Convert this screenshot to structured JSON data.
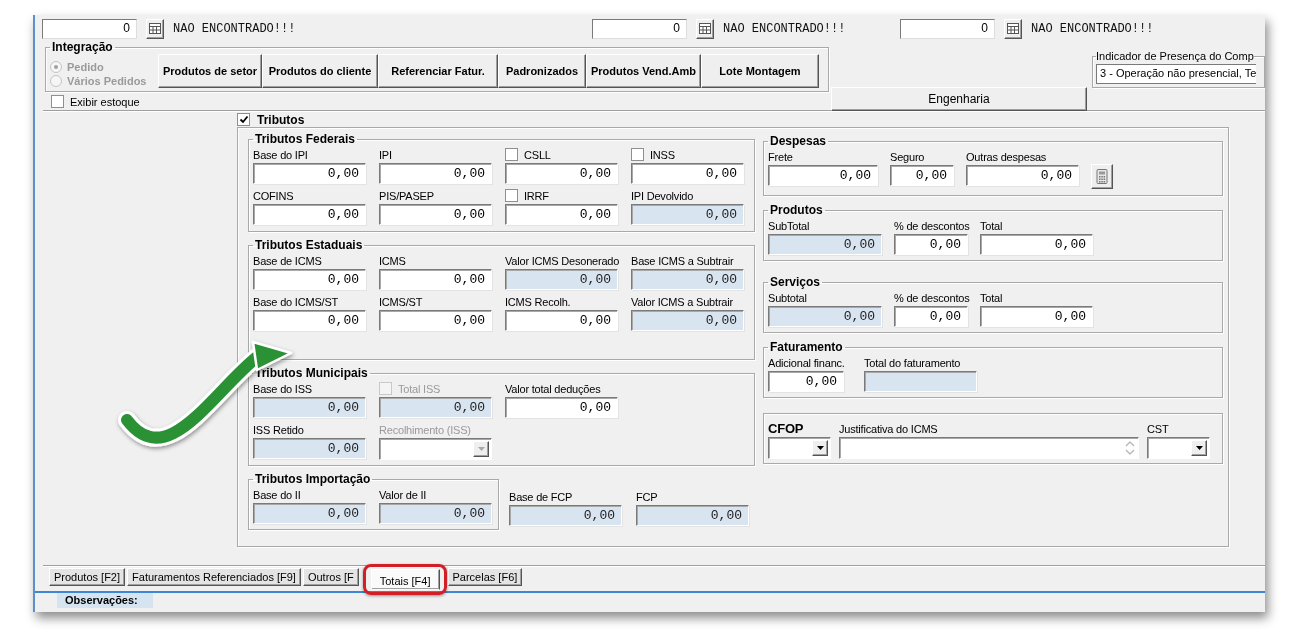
{
  "top_lookups": [
    {
      "value": "0",
      "status": "NAO ENCONTRADO!!!"
    },
    {
      "value": "0",
      "status": "NAO ENCONTRADO!!!"
    },
    {
      "value": "0",
      "status": "NAO ENCONTRADO!!!"
    }
  ],
  "integracao": {
    "title": "Integração",
    "options": [
      {
        "label": "Pedido",
        "selected": true,
        "disabled": true
      },
      {
        "label": "Vários Pedidos",
        "selected": false,
        "disabled": true
      }
    ],
    "buttons": [
      "Produtos de setor",
      "Produtos do cliente",
      "Referenciar Fatur.",
      "Padronizados",
      "Produtos Vend.Amb",
      "Lote Montagem"
    ]
  },
  "exibir_estoque": {
    "label": "Exibir estoque",
    "checked": false
  },
  "engenharia_button": "Engenharia",
  "indicador_presenca": {
    "label": "Indicador de Presença do Comp",
    "value": "3 - Operação não presencial, Te"
  },
  "tributos": {
    "label": "Tributos",
    "checked": true,
    "left_groups": [
      {
        "title": "Tributos Federais",
        "rows": [
          [
            {
              "kind": "text",
              "label": "Base do IPI",
              "value": "0,00",
              "readonly": false
            },
            {
              "kind": "text",
              "label": "IPI",
              "value": "0,00",
              "readonly": false
            },
            {
              "kind": "check_text",
              "label": "CSLL",
              "checked": false,
              "value": "0,00",
              "readonly": false
            },
            {
              "kind": "check_text",
              "label": "INSS",
              "checked": false,
              "value": "0,00",
              "readonly": false
            }
          ],
          [
            {
              "kind": "text",
              "label": "COFINS",
              "value": "0,00",
              "readonly": false
            },
            {
              "kind": "text",
              "label": "PIS/PASEP",
              "value": "0,00",
              "readonly": false
            },
            {
              "kind": "check_text",
              "label": "IRRF",
              "checked": false,
              "value": "0,00",
              "readonly": false
            },
            {
              "kind": "text",
              "label": "IPI Devolvido",
              "value": "0,00",
              "readonly": true
            }
          ]
        ]
      },
      {
        "title": "Tributos Estaduais",
        "rows": [
          [
            {
              "kind": "text",
              "label": "Base de ICMS",
              "value": "0,00",
              "readonly": false
            },
            {
              "kind": "text",
              "label": "ICMS",
              "value": "0,00",
              "readonly": false
            },
            {
              "kind": "text",
              "label": "Valor ICMS Desonerado",
              "value": "0,00",
              "readonly": true
            },
            {
              "kind": "text",
              "label": "Base ICMS a Subtrair",
              "value": "0,00",
              "readonly": true
            }
          ],
          [
            {
              "kind": "text",
              "label": "Base do ICMS/ST",
              "value": "0,00",
              "readonly": false
            },
            {
              "kind": "text",
              "label": "ICMS/ST",
              "value": "0,00",
              "readonly": false
            },
            {
              "kind": "text",
              "label": "ICMS Recolh.",
              "value": "0,00",
              "readonly": false
            },
            {
              "kind": "text",
              "label": "Valor ICMS a Subtrair",
              "value": "0,00",
              "readonly": true
            }
          ]
        ]
      },
      {
        "title": "Tributos Municipais",
        "rows": [
          [
            {
              "kind": "text",
              "label": "Base do ISS",
              "value": "0,00",
              "readonly": true
            },
            {
              "kind": "check_text",
              "label": "Total ISS",
              "checked": false,
              "disabled": true,
              "value": "0,00",
              "readonly": true
            },
            {
              "kind": "text",
              "label": "Valor total deduções",
              "value": "0,00",
              "readonly": false
            }
          ],
          [
            {
              "kind": "text",
              "label": "ISS Retido",
              "value": "0,00",
              "readonly": true
            },
            {
              "kind": "combo",
              "label": "Recolhimento (ISS)",
              "disabled": true
            }
          ]
        ]
      },
      {
        "title": "Tributos Importação",
        "rows": [
          [
            {
              "kind": "text",
              "label": "Base do II",
              "value": "0,00",
              "readonly": true
            },
            {
              "kind": "text",
              "label": "Valor de II",
              "value": "0,00",
              "readonly": true
            }
          ]
        ]
      }
    ],
    "fcp_fields": [
      {
        "kind": "text",
        "label": "Base de FCP",
        "value": "0,00",
        "readonly": true
      },
      {
        "kind": "text",
        "label": "FCP",
        "value": "0,00",
        "readonly": true
      }
    ],
    "right_groups": [
      {
        "title": "Despesas",
        "rows": [
          [
            {
              "kind": "text",
              "label": "Frete",
              "value": "0,00",
              "readonly": false
            },
            {
              "kind": "text",
              "label": "Seguro",
              "value": "0,00",
              "readonly": false
            },
            {
              "kind": "text",
              "label": "Outras despesas",
              "value": "0,00",
              "readonly": false
            },
            {
              "kind": "calc_button"
            }
          ]
        ]
      },
      {
        "title": "Produtos",
        "rows": [
          [
            {
              "kind": "text",
              "label": "SubTotal",
              "value": "0,00",
              "readonly": true
            },
            {
              "kind": "text",
              "label": "% de descontos",
              "value": "0,00",
              "readonly": false
            },
            {
              "kind": "text",
              "label": "Total",
              "value": "0,00",
              "readonly": false
            }
          ]
        ]
      },
      {
        "title": "Serviços",
        "rows": [
          [
            {
              "kind": "text",
              "label": "Subtotal",
              "value": "0,00",
              "readonly": true
            },
            {
              "kind": "text",
              "label": "% de descontos",
              "value": "0,00",
              "readonly": false
            },
            {
              "kind": "text",
              "label": "Total",
              "value": "0,00",
              "readonly": false
            }
          ]
        ]
      },
      {
        "title": "Faturamento",
        "rows": [
          [
            {
              "kind": "text",
              "label": "Adicional financ.",
              "value": "0,00",
              "readonly": false
            },
            {
              "kind": "text",
              "label": "Total do faturamento",
              "readonly": true
            }
          ]
        ]
      },
      {
        "rows": [
          [
            {
              "kind": "combo",
              "label": "CFOP",
              "emphasis": true
            },
            {
              "kind": "memo",
              "label": "Justificativa do ICMS"
            },
            {
              "kind": "combo",
              "label": "CST"
            }
          ]
        ]
      }
    ]
  },
  "tabs": [
    {
      "label": "Produtos [F2]",
      "selected": false
    },
    {
      "label": "Faturamentos Referenciados [F9]",
      "selected": false
    },
    {
      "label": "Outros [F",
      "selected": false
    },
    {
      "label": "Totais [F4]",
      "selected": true
    },
    {
      "label": "Parcelas [F6]",
      "selected": false
    }
  ],
  "observacoes_label": "Observações:"
}
